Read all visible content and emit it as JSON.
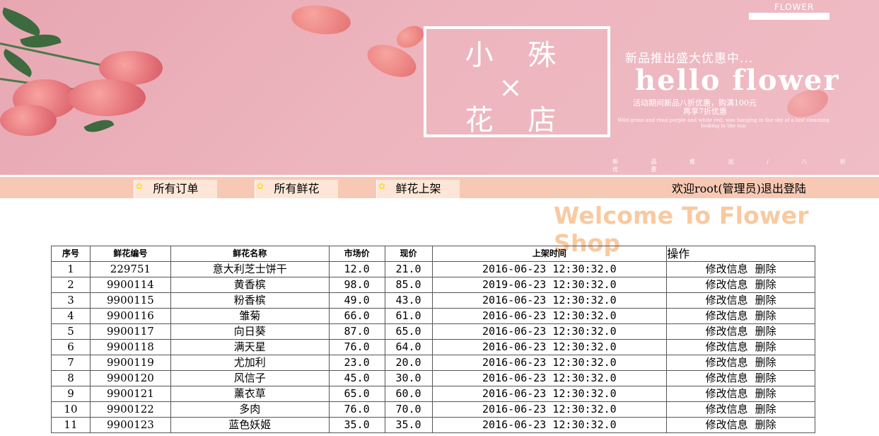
{
  "banner": {
    "brand": "FLOWER",
    "title_line1": "小 殊",
    "title_line2": "×",
    "title_line3": "花 店",
    "promo_line1": "新品推出盛大优惠中...",
    "promo_hello": "hello flower",
    "promo_line2": "活动期间新品八折优惠，购满100元",
    "promo_line3": "再享7折优惠",
    "promo_line4": "Wild grass and read purple and white red, was hanging in the sky of a lost steaming looking in the sun",
    "promo_dots": "新 品 推 出 / 八 折 优 惠"
  },
  "nav": {
    "tabs": [
      {
        "label": "所有订单"
      },
      {
        "label": "所有鲜花"
      },
      {
        "label": "鲜花上架"
      }
    ],
    "user_text": "欢迎root(管理员)退出登陆"
  },
  "welcome": "Welcome To Flower Shop",
  "table": {
    "headers": [
      "序号",
      "鲜花编号",
      "鲜花名称",
      "市场价",
      "现价",
      "上架时间",
      "操作"
    ],
    "edit_label": "修改信息",
    "delete_label": "删除",
    "rows": [
      {
        "idx": "1",
        "code": "229751",
        "name": "意大利芝士饼干",
        "market": "12.0",
        "price": "21.0",
        "time": "2016-06-23 12:30:32.0"
      },
      {
        "idx": "2",
        "code": "9900114",
        "name": "黄香槟",
        "market": "98.0",
        "price": "85.0",
        "time": "2019-06-23 12:30:32.0"
      },
      {
        "idx": "3",
        "code": "9900115",
        "name": "粉香槟",
        "market": "49.0",
        "price": "43.0",
        "time": "2016-06-23 12:30:32.0"
      },
      {
        "idx": "4",
        "code": "9900116",
        "name": "雏菊",
        "market": "66.0",
        "price": "61.0",
        "time": "2016-06-23 12:30:32.0"
      },
      {
        "idx": "5",
        "code": "9900117",
        "name": "向日葵",
        "market": "87.0",
        "price": "65.0",
        "time": "2016-06-23 12:30:32.0"
      },
      {
        "idx": "6",
        "code": "9900118",
        "name": "满天星",
        "market": "76.0",
        "price": "64.0",
        "time": "2016-06-23 12:30:32.0"
      },
      {
        "idx": "7",
        "code": "9900119",
        "name": "尤加利",
        "market": "23.0",
        "price": "20.0",
        "time": "2016-06-23 12:30:32.0"
      },
      {
        "idx": "8",
        "code": "9900120",
        "name": "风信子",
        "market": "45.0",
        "price": "30.0",
        "time": "2016-06-23 12:30:32.0"
      },
      {
        "idx": "9",
        "code": "9900121",
        "name": "薰衣草",
        "market": "65.0",
        "price": "60.0",
        "time": "2016-06-23 12:30:32.0"
      },
      {
        "idx": "10",
        "code": "9900122",
        "name": "多肉",
        "market": "76.0",
        "price": "70.0",
        "time": "2016-06-23 12:30:32.0"
      },
      {
        "idx": "11",
        "code": "9900123",
        "name": "蓝色妖姬",
        "market": "35.0",
        "price": "35.0",
        "time": "2016-06-23 12:30:32.0"
      }
    ]
  },
  "colors": {
    "banner_pink": "#edb5be",
    "nav_bg": "#f7c9b4",
    "welcome": "#f9c9a0"
  }
}
